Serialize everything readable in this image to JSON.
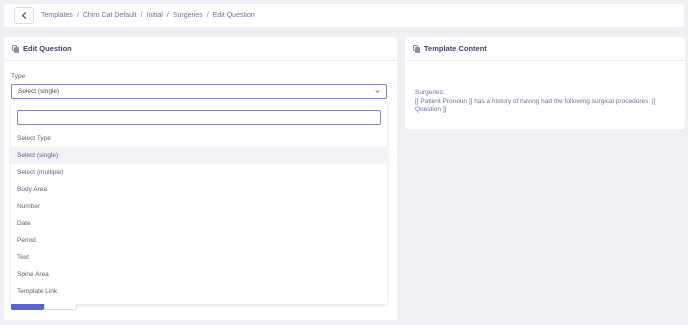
{
  "breadcrumb": {
    "items": [
      "Templates",
      "Chiro Cat Default",
      "Initial",
      "Surgeries"
    ],
    "current": "Edit Question",
    "separator": "/"
  },
  "edit_question": {
    "title": "Edit Question",
    "type_label": "Type",
    "selected_value": "Select (single)",
    "search": {
      "value": "",
      "placeholder": ""
    },
    "options": [
      "Select Type",
      "Select (single)",
      "Select (multiple)",
      "Body Area",
      "Number",
      "Date",
      "Period",
      "Text",
      "Spine Area",
      "Template Link"
    ],
    "highlighted_option": "Select (single)"
  },
  "template_content": {
    "title": "Template Content",
    "line1": "Surgeries:",
    "line2": "[[ Patient Pronoun ]] has a history of having had the following surgical procedures: [[ Question ]]"
  },
  "colors": {
    "accent": "#5b63d3",
    "focus_border": "#7f87c4",
    "link": "#6b72a6",
    "background": "#eef0f5"
  },
  "icons": {
    "back": "chevron-left-icon",
    "card_header": "copy-document-icon",
    "select_toggle": "chevron-down-icon"
  }
}
